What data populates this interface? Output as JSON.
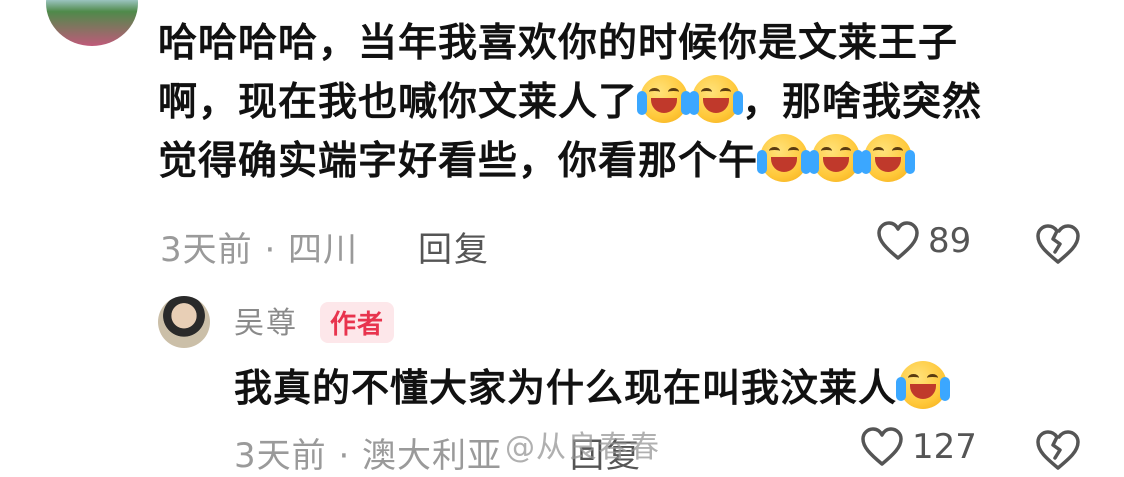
{
  "comment": {
    "lines": [
      "哈哈哈哈，当年我喜欢你的时候你是文莱王子",
      "啊，现在我也喊你文莱人了",
      "，那啥我突然",
      "觉得确实端字好看些，你看那个午"
    ],
    "meta": "3天前 · 四川",
    "reply_label": "回复",
    "like_count": "89"
  },
  "reply": {
    "author": "吴尊",
    "badge": "作者",
    "text": "我真的不懂大家为什么现在叫我汶莱人",
    "meta": "3天前 · 澳大利亚",
    "reply_label": "回复",
    "like_count": "127"
  },
  "watermark": "@从良春春",
  "icons": {
    "like": "heart-outline-icon",
    "dislike": "broken-heart-icon",
    "emoji": "loudly-crying-face-icon"
  }
}
